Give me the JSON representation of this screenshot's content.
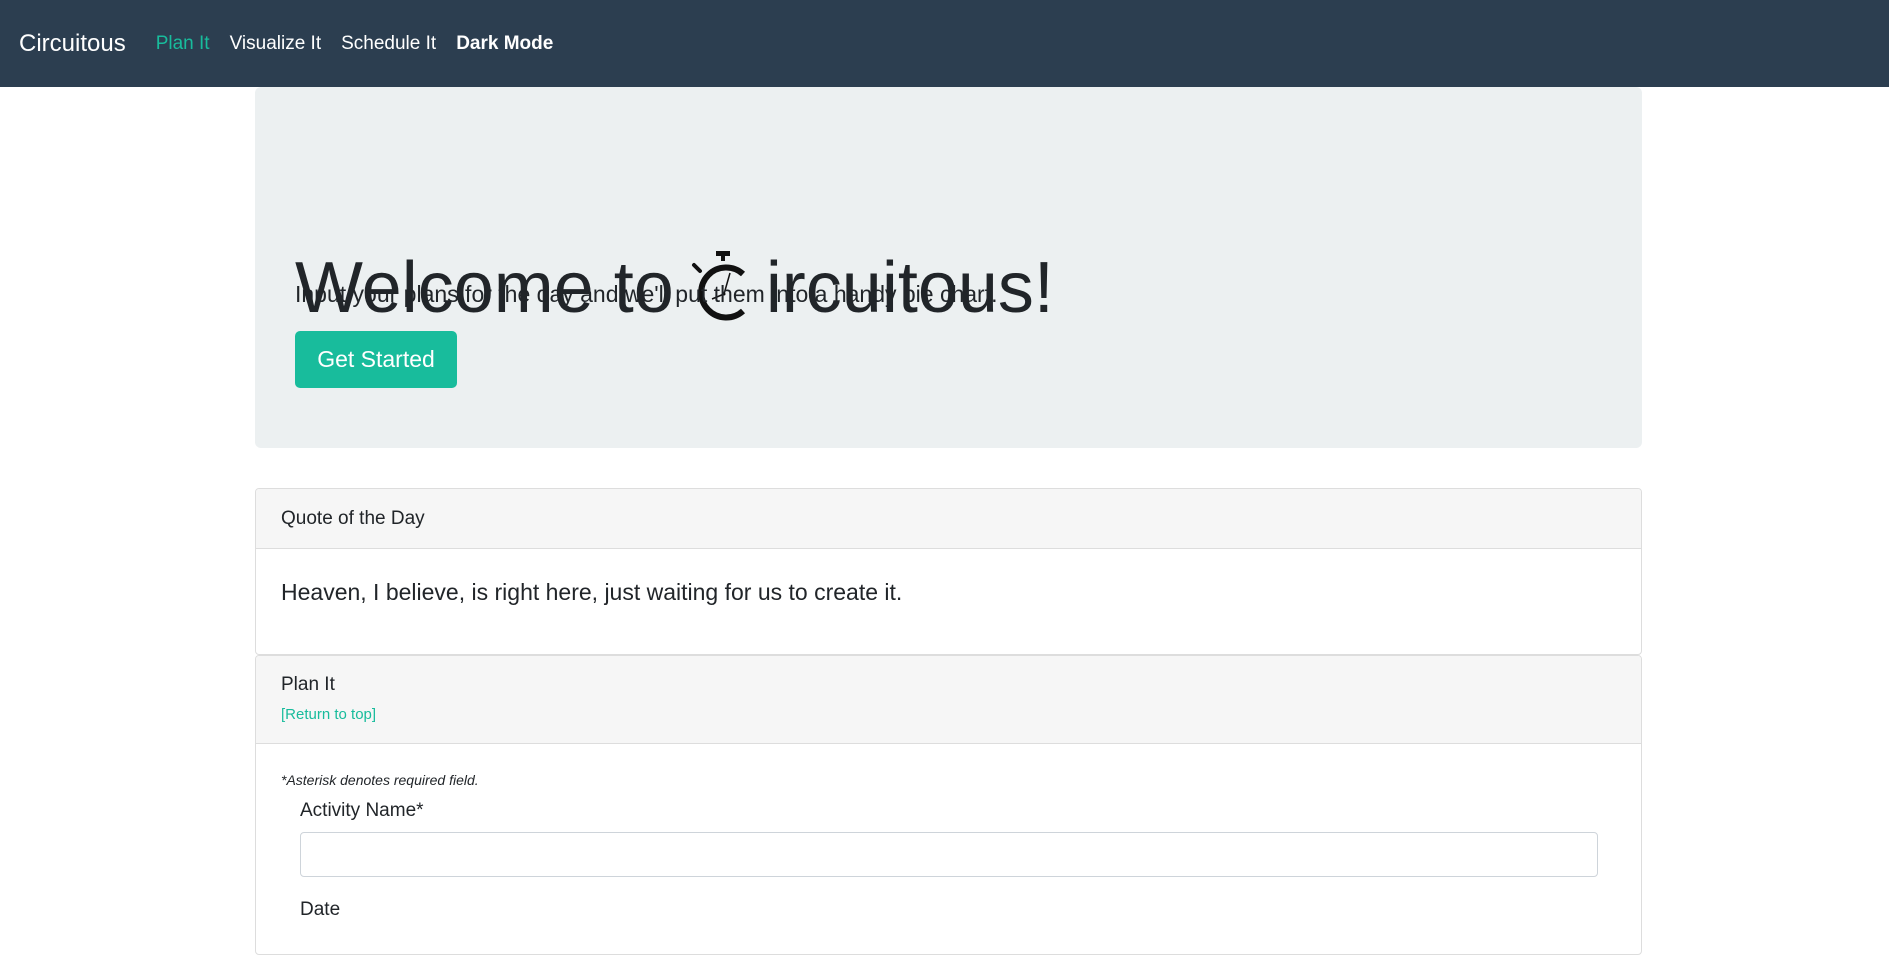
{
  "navbar": {
    "brand": "Circuitous",
    "links": [
      {
        "label": "Plan It",
        "active": true
      },
      {
        "label": "Visualize It",
        "active": false
      },
      {
        "label": "Schedule It",
        "active": false
      },
      {
        "label": "Dark Mode",
        "active": false
      }
    ]
  },
  "hero": {
    "title_prefix": "Welcome to",
    "title_suffix": "ircuitous!",
    "logo_icon": "stopwatch-c-icon",
    "lead": "Input your plans for the day and we'll put them into a handy pie chart.",
    "cta_label": "Get Started"
  },
  "quote": {
    "header": "Quote of the Day",
    "text": "Heaven, I believe, is right here, just waiting for us to create it."
  },
  "plan": {
    "header": "Plan It",
    "return_link": "[Return to top]",
    "required_note": "*Asterisk denotes required field.",
    "activity_label": "Activity Name*",
    "activity_value": "",
    "date_label": "Date"
  },
  "colors": {
    "navbar_bg": "#2c3e50",
    "accent": "#18bc9c",
    "jumbotron_bg": "#ecf0f1"
  }
}
